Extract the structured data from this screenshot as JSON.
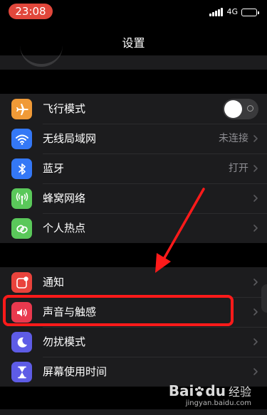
{
  "status_bar": {
    "time": "23:08",
    "network": "4G"
  },
  "nav": {
    "title": "设置"
  },
  "groups": [
    {
      "items": [
        {
          "label": "飞行模式",
          "icon": "airplane-icon",
          "color": "#f09a37",
          "control": "toggle",
          "toggle_on": false
        },
        {
          "label": "无线局域网",
          "icon": "wifi-icon",
          "color": "#3478f6",
          "value": "未连接",
          "control": "chevron"
        },
        {
          "label": "蓝牙",
          "icon": "bluetooth-icon",
          "color": "#3478f6",
          "value": "打开",
          "control": "chevron"
        },
        {
          "label": "蜂窝网络",
          "icon": "cellular-antenna-icon",
          "color": "#5ac85a",
          "control": "chevron"
        },
        {
          "label": "个人热点",
          "icon": "hotspot-link-icon",
          "color": "#5ac85a",
          "control": "chevron"
        }
      ]
    },
    {
      "items": [
        {
          "label": "通知",
          "icon": "notification-icon",
          "color": "#e9433c",
          "control": "chevron"
        },
        {
          "label": "声音与触感",
          "icon": "speaker-icon",
          "color": "#e9394e",
          "control": "chevron"
        },
        {
          "label": "勿扰模式",
          "icon": "moon-icon",
          "color": "#5e5ce6",
          "control": "chevron"
        },
        {
          "label": "屏幕使用时间",
          "icon": "hourglass-icon",
          "color": "#5e5ce6",
          "control": "chevron"
        }
      ]
    }
  ],
  "annotation": {
    "highlight_color": "#ff1a1a",
    "highlighted_item": "声音与触感"
  },
  "watermark": {
    "logo_text": "Bai",
    "logo_suffix": "du",
    "sub_title": "经验",
    "url": "jingyan.baidu.com"
  }
}
